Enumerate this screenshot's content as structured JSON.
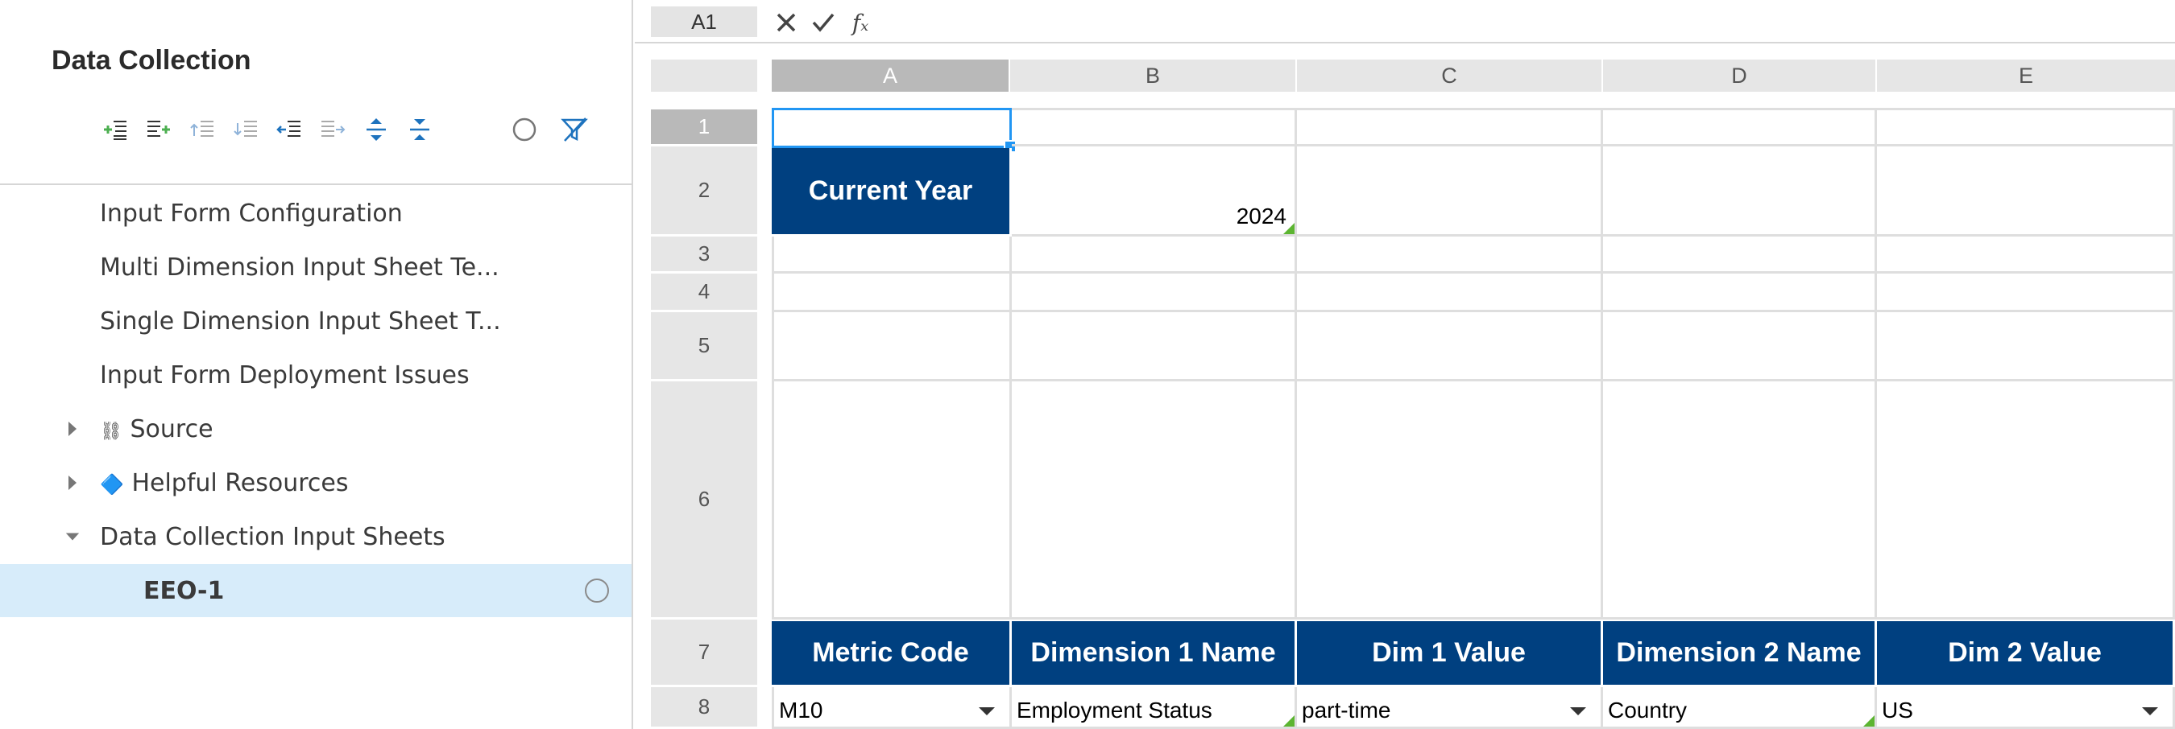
{
  "panel": {
    "title": "Data Collection",
    "toolbar": [
      {
        "icon": "indent-add-icon"
      },
      {
        "icon": "indent-add-child-icon"
      },
      {
        "icon": "indent-increase-icon"
      },
      {
        "icon": "indent-list-icon"
      },
      {
        "icon": "outdent-icon"
      },
      {
        "icon": "indent-right-icon"
      },
      {
        "icon": "expand-all-icon"
      },
      {
        "icon": "collapse-all-icon"
      },
      {
        "icon": "circle-status-icon"
      },
      {
        "icon": "filter-clear-icon"
      }
    ],
    "tree": [
      {
        "label": "Input Form Configuration",
        "level": 1
      },
      {
        "label": "Multi Dimension Input Sheet Te...",
        "level": 1
      },
      {
        "label": "Single Dimension Input Sheet T...",
        "level": 1
      },
      {
        "label": "Input Form Deployment Issues",
        "level": 1
      },
      {
        "label": "Source",
        "prefix": "⛓",
        "caret": "collapsed",
        "level": 1
      },
      {
        "label": "Helpful Resources",
        "prefix": "🔷",
        "caret": "collapsed",
        "level": 1
      },
      {
        "label": "Data Collection Input Sheets",
        "caret": "expanded",
        "level": 1
      },
      {
        "label": "EEO-1",
        "level": 2,
        "selected": true
      }
    ]
  },
  "formula": {
    "cell_ref": "A1",
    "cancel_icon": "✕",
    "confirm_icon": "✓",
    "fx_icon": "𝑓ₓ"
  },
  "grid": {
    "columns": [
      "A",
      "B",
      "C",
      "D",
      "E"
    ],
    "rows": [
      "1",
      "2",
      "3",
      "4",
      "5",
      "6",
      "7",
      "8"
    ],
    "current_year_label": "Current Year",
    "current_year_value": "2024",
    "headers": [
      "Metric Code",
      "Dimension 1 Name",
      "Dim 1 Value",
      "Dimension 2 Name",
      "Dim 2 Value"
    ],
    "row8": [
      "M10",
      "Employment Status",
      "part-time",
      "Country",
      "US"
    ]
  },
  "colors": {
    "header_fill": "#004080",
    "selection": "#2196f3",
    "tree_selected": "#d7ecfa",
    "validation_marker": "#5cb531"
  }
}
